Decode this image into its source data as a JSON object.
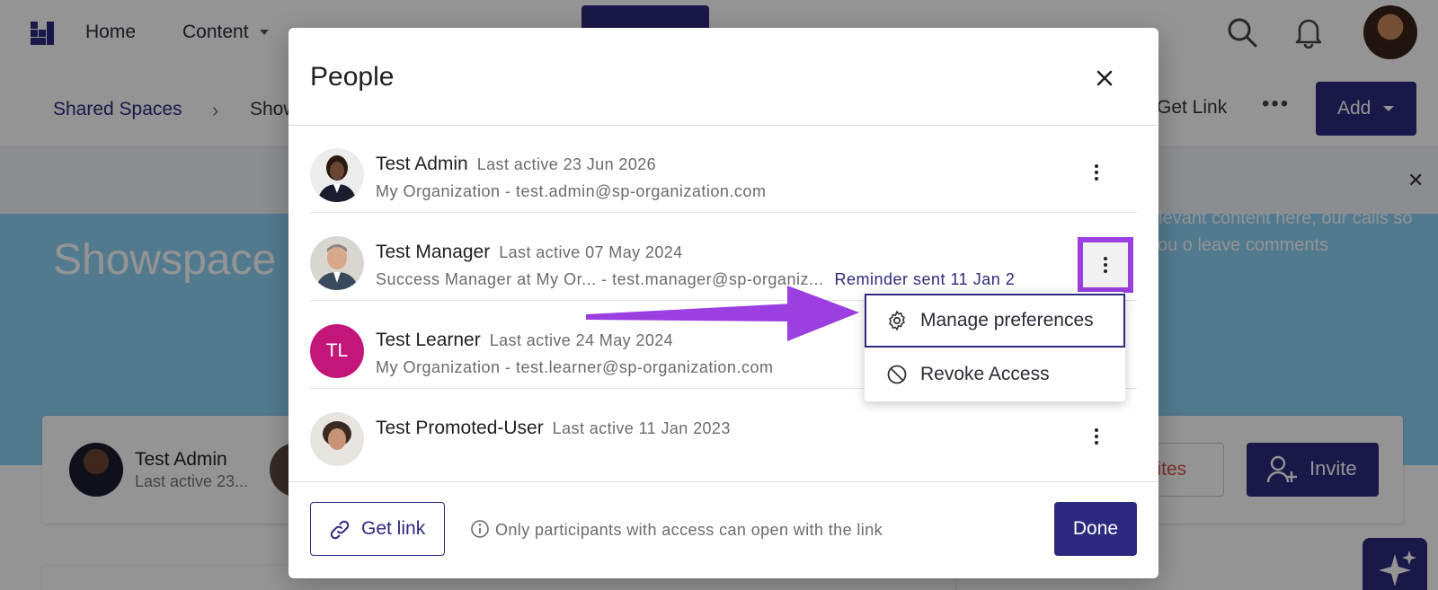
{
  "topnav": {
    "home": "Home",
    "content": "Content"
  },
  "subnav": {
    "breadcrumb_root": "Shared Spaces",
    "breadcrumb_current": "Show",
    "get_link": "Get Link",
    "add_button": "Add"
  },
  "hero": {
    "title": "Showspace a",
    "text": "elevant content here, our calls so you o leave comments"
  },
  "people_card": {
    "name": "Test Admin",
    "sub": "Last active 23...",
    "invites_label": "vites",
    "invite_button": "Invite"
  },
  "modal": {
    "title": "People",
    "people": [
      {
        "name": "Test Admin",
        "last_active": "Last active 23 Jun 2026",
        "line2": "My Organization - test.admin@sp-organization.com",
        "reminder": ""
      },
      {
        "name": "Test Manager",
        "last_active": "Last active 07 May 2024",
        "line2": "Success Manager at My Or...  - test.manager@sp-organiz...",
        "reminder": "Reminder sent 11 Jan 2"
      },
      {
        "name": "Test Learner",
        "initials": "TL",
        "last_active": "Last active 24 May 2024",
        "line2": "My Organization - test.learner@sp-organization.com",
        "reminder": ""
      },
      {
        "name": "Test Promoted-User",
        "last_active": "Last active 11 Jan 2023",
        "line2": "",
        "reminder": ""
      }
    ],
    "footer": {
      "get_link": "Get link",
      "hint": "Only participants with access can open with the link",
      "done": "Done"
    }
  },
  "menu": {
    "items": [
      {
        "label": "Manage preferences",
        "icon": "gear-icon"
      },
      {
        "label": "Revoke Access",
        "icon": "block-icon"
      }
    ]
  },
  "colors": {
    "brand": "#2c2a7e",
    "highlight": "#9b3fe0",
    "learner_avatar": "#c4157a",
    "hero": "#8ed3f6"
  }
}
